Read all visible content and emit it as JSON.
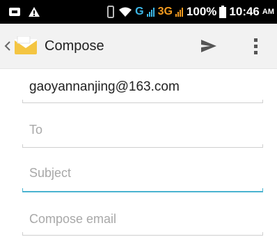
{
  "status_bar": {
    "network_1": "G",
    "network_2": "3G",
    "battery": "100%",
    "time": "10:46",
    "ampm": "AM"
  },
  "action_bar": {
    "title": "Compose"
  },
  "compose": {
    "from": "gaoyannanjing@163.com",
    "to_placeholder": "To",
    "subject_placeholder": "Subject",
    "body_placeholder": "Compose email"
  },
  "colors": {
    "accent": "#4ab3d0",
    "status_bar": "#000000",
    "action_bar": "#f2f2f2"
  }
}
